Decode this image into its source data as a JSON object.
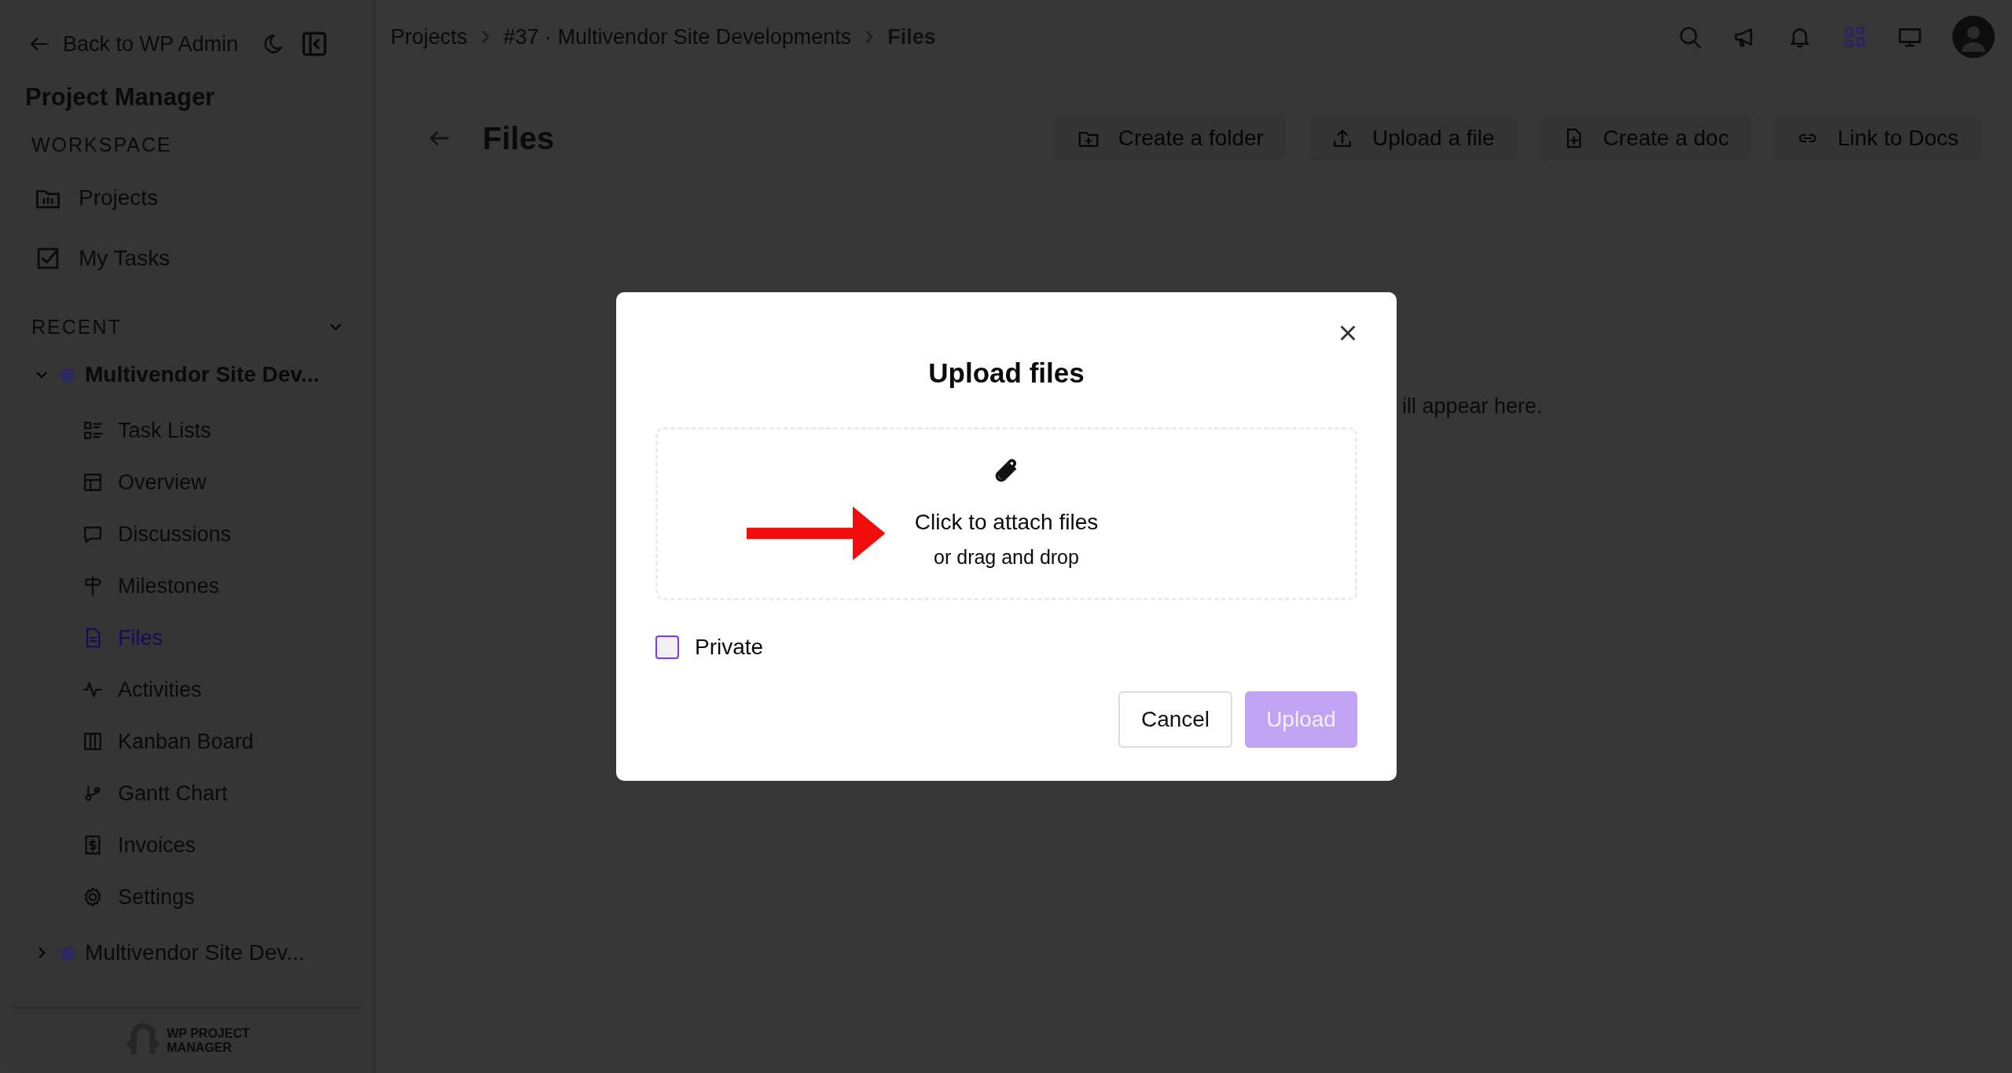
{
  "sidebar": {
    "back_link": "Back to WP Admin",
    "title": "Project Manager",
    "workspace": {
      "heading": "WORKSPACE",
      "items": [
        "Projects",
        "My Tasks"
      ]
    },
    "recent": {
      "heading": "RECENT",
      "expanded": true,
      "projects": [
        {
          "name": "Multivendor Site Dev...",
          "expanded": true,
          "children": [
            {
              "label": "Task Lists",
              "selected": false
            },
            {
              "label": "Overview",
              "selected": false
            },
            {
              "label": "Discussions",
              "selected": false
            },
            {
              "label": "Milestones",
              "selected": false
            },
            {
              "label": "Files",
              "selected": true
            },
            {
              "label": "Activities",
              "selected": false
            },
            {
              "label": "Kanban Board",
              "selected": false
            },
            {
              "label": "Gantt Chart",
              "selected": false
            },
            {
              "label": "Invoices",
              "selected": false
            },
            {
              "label": "Settings",
              "selected": false
            }
          ]
        },
        {
          "name": "Multivendor Site Dev...",
          "expanded": false
        }
      ]
    },
    "logo": {
      "line_1": "WP PROJECT",
      "line_2": "MANAGER"
    }
  },
  "breadcrumbs": [
    "Projects",
    "#37 · Multivendor Site Developments",
    "Files"
  ],
  "page": {
    "title": "Files",
    "actions": [
      "Create a folder",
      "Upload a file",
      "Create a doc",
      "Link to Docs"
    ],
    "empty_text": "ill appear here."
  },
  "modal": {
    "title": "Upload files",
    "dropzone": {
      "prompt": "Click to attach files",
      "hint": "or drag and drop"
    },
    "private": {
      "label": "Private",
      "checked": false
    },
    "buttons": [
      {
        "label": "Cancel",
        "kind": "secondary",
        "disabled": false
      },
      {
        "label": "Upload",
        "kind": "primary",
        "disabled": true
      }
    ]
  }
}
